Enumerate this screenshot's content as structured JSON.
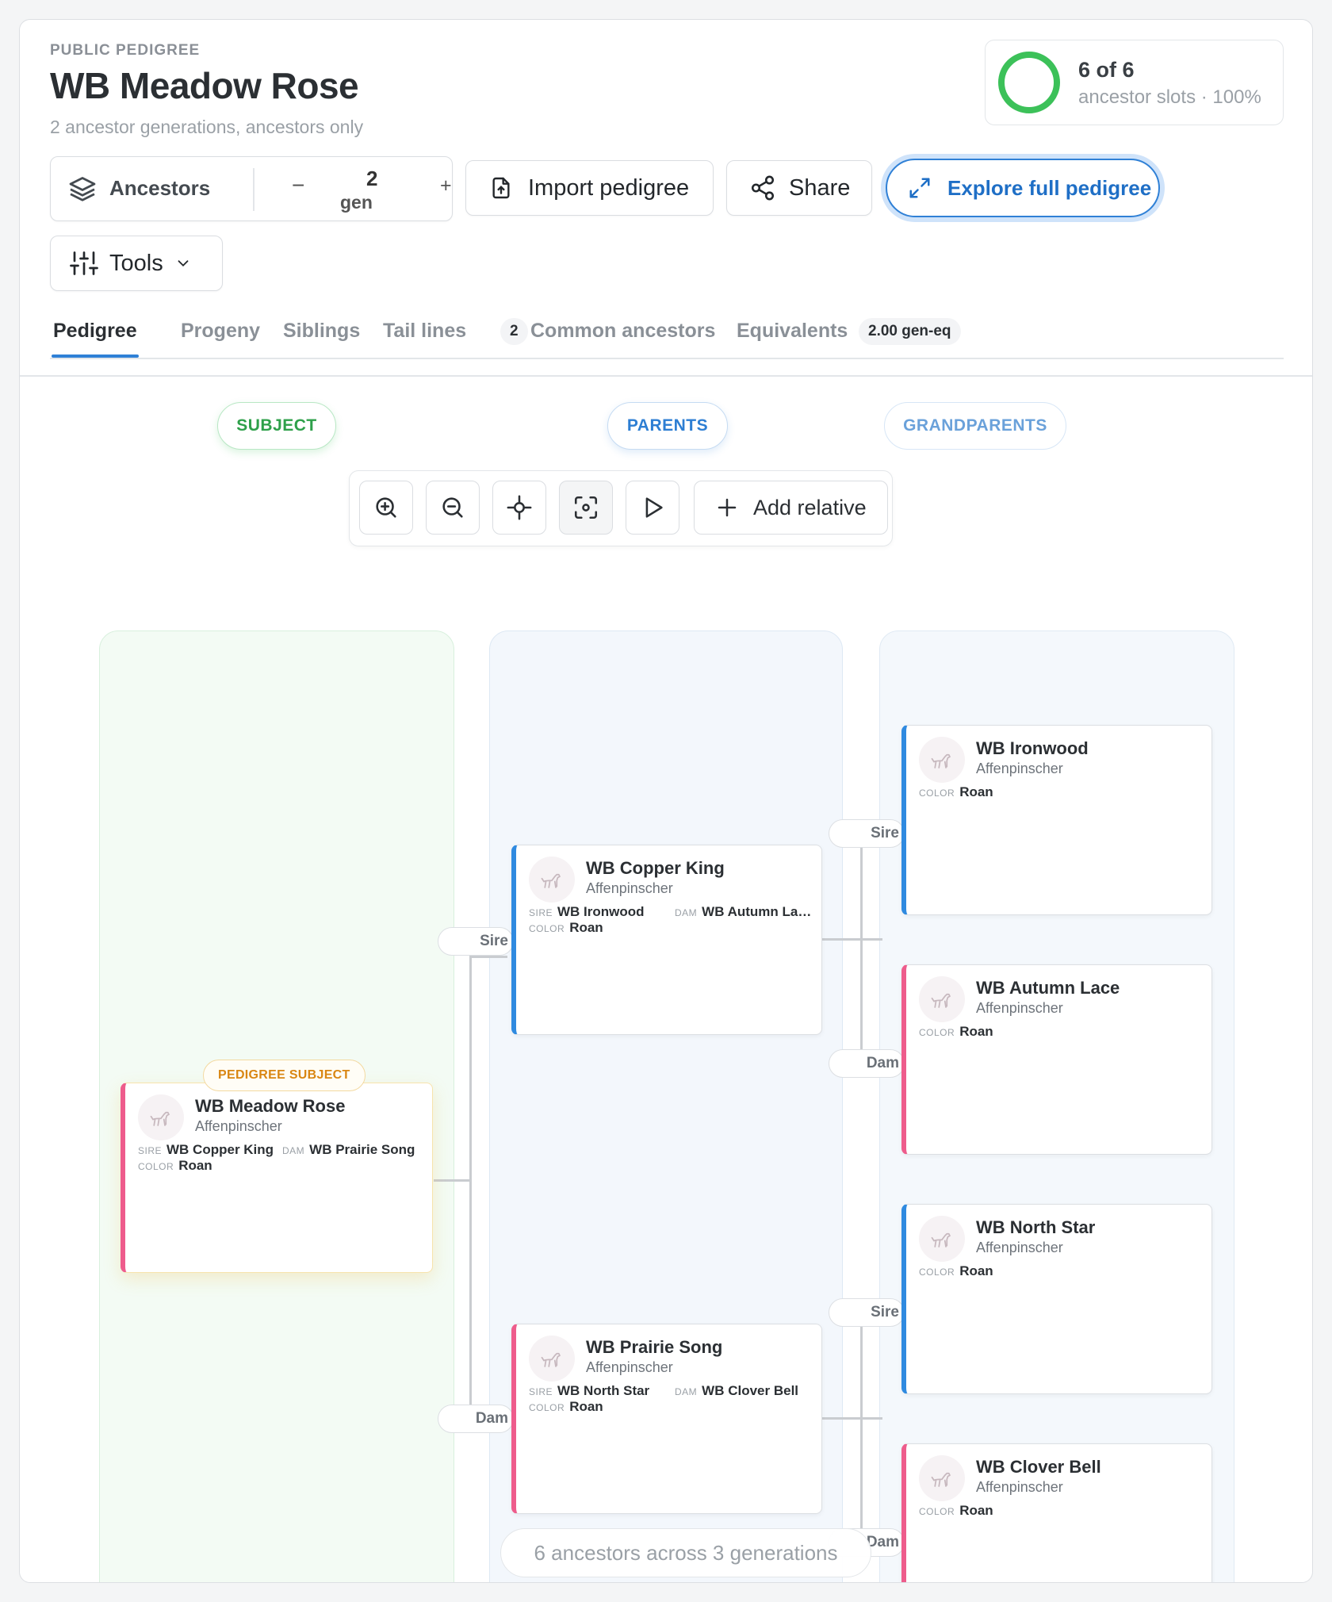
{
  "header": {
    "eyebrow": "PUBLIC PEDIGREE",
    "title": "WB Meadow Rose",
    "subtitle": "2 ancestor generations, ancestors only"
  },
  "stat": {
    "main": "6 of 6",
    "sub": "ancestor slots · 100%",
    "fill_fraction": 1.0,
    "ring_color": "#3cc159"
  },
  "controls": {
    "mode_label": "Ancestors",
    "minus": "−",
    "gen_value": "2",
    "gen_unit": "gen",
    "plus": "+",
    "import_label": "Import pedigree",
    "share_label": "Share",
    "explore_label": "Explore full pedigree",
    "tools_label": "Tools"
  },
  "tabs": [
    {
      "label": "Pedigree",
      "active": true
    },
    {
      "label": "Progeny"
    },
    {
      "label": "Siblings"
    },
    {
      "label": "Tail lines",
      "badge": "2"
    },
    {
      "label": "Common ancestors"
    },
    {
      "label": "Equivalents",
      "badge": "2.00 gen-eq"
    }
  ],
  "generations": {
    "subject": "SUBJECT",
    "parents": "PARENTS",
    "grandparents": "GRANDPARENTS"
  },
  "toolbar": {
    "tools": [
      "zoom-in-icon",
      "zoom-out-icon",
      "center-icon",
      "fit-view-icon",
      "play-icon"
    ],
    "add_relative": "Add relative"
  },
  "edges": {
    "sire": "Sire",
    "dam": "Dam"
  },
  "keys": {
    "sire": "SIRE",
    "dam": "DAM",
    "color": "COLOR"
  },
  "subject": {
    "tag": "PEDIGREE SUBJECT",
    "name": "WB Meadow Rose",
    "breed": "Affenpinscher",
    "sire": "WB Copper King",
    "dam": "WB Prairie Song",
    "color": "Roan"
  },
  "parents": [
    {
      "role": "Sire",
      "name": "WB Copper King",
      "breed": "Affenpinscher",
      "sire": "WB Ironwood",
      "dam": "WB Autumn La…",
      "color": "Roan"
    },
    {
      "role": "Dam",
      "name": "WB Prairie Song",
      "breed": "Affenpinscher",
      "sire": "WB North Star",
      "dam": "WB Clover Bell",
      "color": "Roan"
    }
  ],
  "grandparents": [
    {
      "role": "Sire",
      "name": "WB Ironwood",
      "breed": "Affenpinscher",
      "color": "Roan"
    },
    {
      "role": "Dam",
      "name": "WB Autumn Lace",
      "breed": "Affenpinscher",
      "color": "Roan"
    },
    {
      "role": "Sire",
      "name": "WB North Star",
      "breed": "Affenpinscher",
      "color": "Roan"
    },
    {
      "role": "Dam",
      "name": "WB Clover Bell",
      "breed": "Affenpinscher",
      "color": "Roan"
    }
  ],
  "footer": "6 ancestors across 3 generations",
  "colors": {
    "accent": "#2f80d6",
    "sire": "#2f8ae0",
    "dam": "#ee5c8c",
    "subject": "#2ea04a",
    "tag": "#d98613"
  }
}
